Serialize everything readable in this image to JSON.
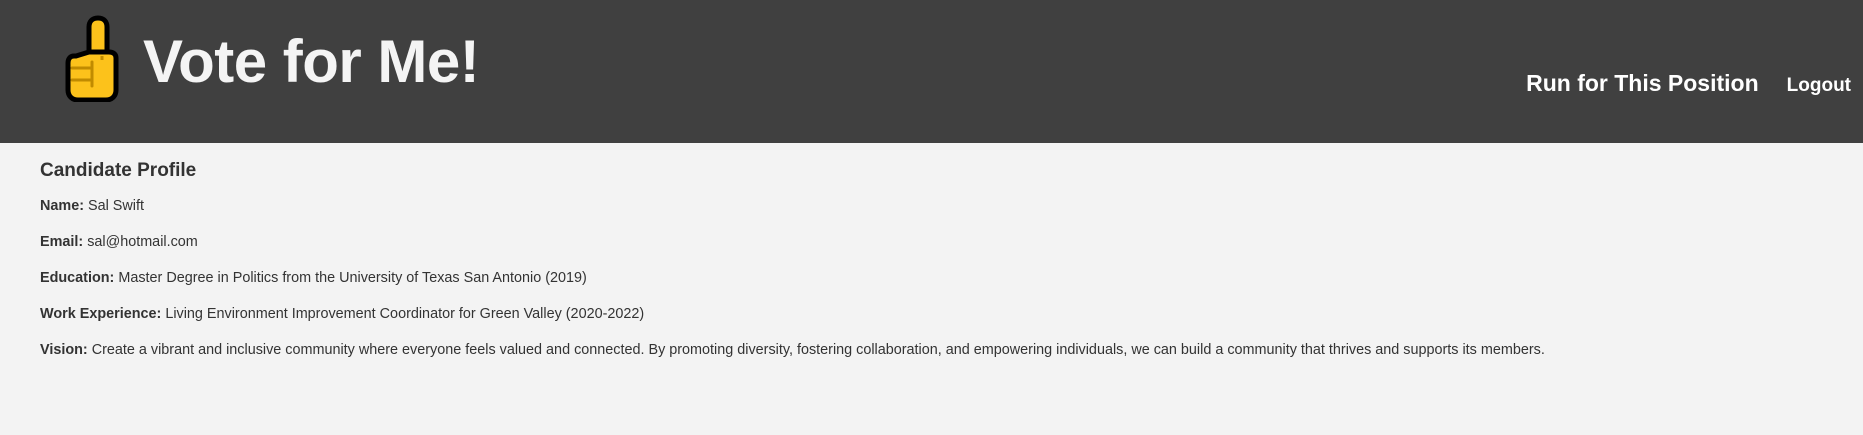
{
  "header": {
    "logo_icon": "pointing-up-hand-emoji",
    "site_title": "Vote for Me!",
    "nav": {
      "run_label": "Run for This Position",
      "logout_label": "Logout"
    }
  },
  "profile": {
    "heading": "Candidate Profile",
    "fields": [
      {
        "label": "Name:",
        "value": "Sal Swift"
      },
      {
        "label": "Email:",
        "value": "sal@hotmail.com"
      },
      {
        "label": "Education:",
        "value": "Master Degree in Politics from the University of Texas San Antonio (2019)"
      },
      {
        "label": "Work Experience:",
        "value": "Living Environment Improvement Coordinator for Green Valley (2020-2022)"
      },
      {
        "label": "Vision:",
        "value": "Create a vibrant and inclusive community where everyone feels valued and connected. By promoting diversity, fostering collaboration, and empowering individuals, we can build a community that thrives and supports its members."
      }
    ]
  },
  "colors": {
    "header_bg": "#404040",
    "page_bg": "#f3f3f3",
    "title_text": "#f4f4f4",
    "body_text": "#333333",
    "emoji_fill": "#fcc21b"
  }
}
